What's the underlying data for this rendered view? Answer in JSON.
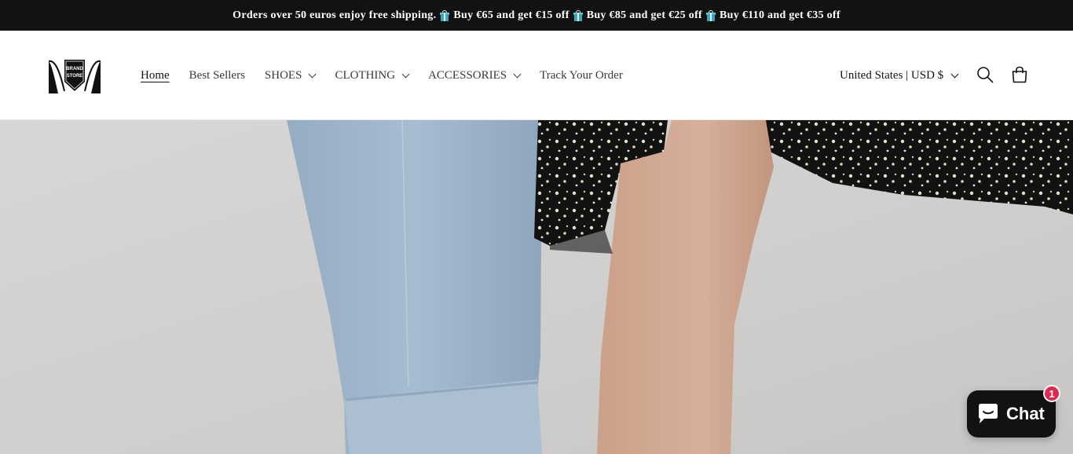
{
  "announcement": {
    "segments": [
      "Orders over 50 euros enjoy free shipping.",
      "Buy €65 and get €15 off",
      "Buy €85 and get €25 off",
      "Buy €110 and get €35 off"
    ],
    "icon": "gift-icon"
  },
  "header": {
    "logo_text_1": "BRAND",
    "logo_text_2": "STORE",
    "nav": [
      {
        "label": "Home",
        "active": true
      },
      {
        "label": "Best Sellers"
      },
      {
        "label": "SHOES",
        "dropdown": true
      },
      {
        "label": "CLOTHING",
        "dropdown": true
      },
      {
        "label": "ACCESSORIES",
        "dropdown": true
      },
      {
        "label": "Track Your Order"
      }
    ],
    "country_selector": "United States | USD $",
    "icons": {
      "search": "search-icon",
      "cart": "cart-icon"
    }
  },
  "chat": {
    "label": "Chat",
    "badge": "1"
  },
  "colors": {
    "announcement_bg": "#121212",
    "chat_bg": "#121212",
    "badge": "#e0294f"
  }
}
